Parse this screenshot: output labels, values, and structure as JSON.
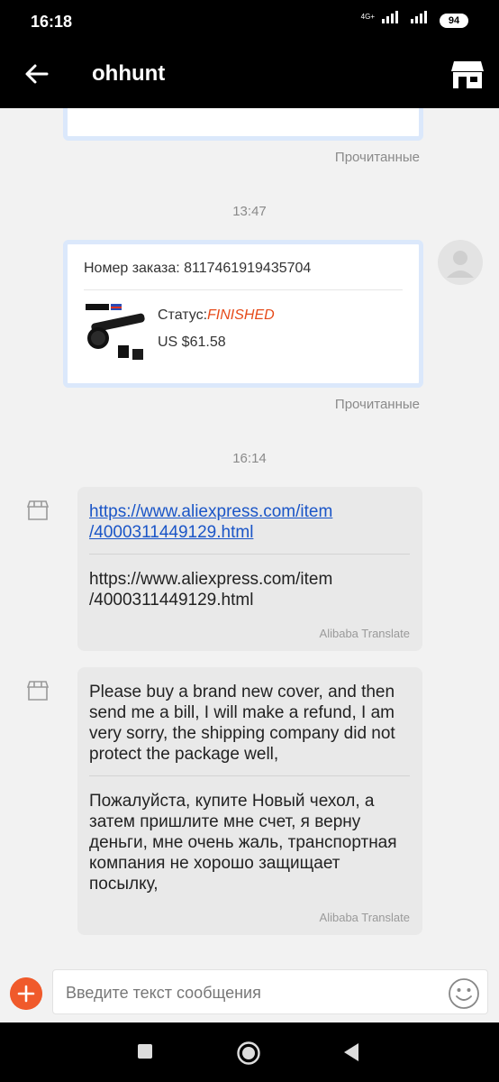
{
  "status_bar": {
    "time": "16:18",
    "network": "4G+",
    "battery": "94"
  },
  "header": {
    "title": "ohhunt"
  },
  "chat": {
    "prev_card": {
      "read_status": "Прочитанные"
    },
    "timestamp_1": "13:47",
    "order_card": {
      "order_number": "Номер заказа: 8117461919435704",
      "status_label": "Статус:",
      "status_value": "FINISHED",
      "price": "US $61.58",
      "read_status": "Прочитанные"
    },
    "timestamp_2": "16:14",
    "messages": [
      {
        "original_line1": "https://www.aliexpress.com/item",
        "original_line2": "/4000311449129.html",
        "translated_line1": "https://www.aliexpress.com/item",
        "translated_line2": "/4000311449129.html",
        "translator": "Alibaba Translate"
      },
      {
        "original": "Please buy a brand new cover, and then send me a bill, I will make a refund, I am very sorry, the shipping company did not protect the package well,",
        "translated": "Пожалуйста, купите Новый чехол, а затем пришлите мне счет, я верну деньги, мне очень жаль, транспортная компания не хорошо защищает посылку,",
        "translator": "Alibaba Translate"
      }
    ]
  },
  "input": {
    "placeholder": "Введите текст сообщения"
  },
  "colors": {
    "accent": "#f05a2b",
    "status_finished": "#e64a19",
    "link": "#1a55c7",
    "card_border": "#dbe8fb"
  }
}
